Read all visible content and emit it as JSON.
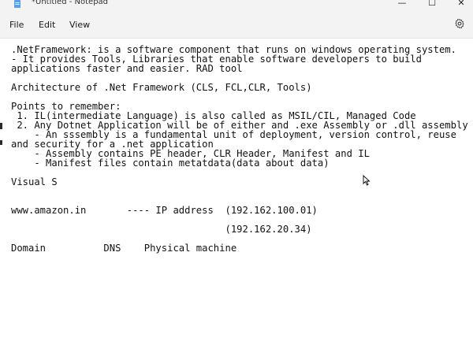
{
  "window": {
    "title": "*Untitled - Notepad",
    "minimize": "—",
    "maximize": "☐",
    "close": "✕"
  },
  "menu": {
    "items": [
      "File",
      "Edit",
      "View"
    ],
    "settings_icon": "gear-icon"
  },
  "document": {
    "lines": [
      ".NetFramework: is a software component that runs on windows operating system.",
      "- It provides Tools, Libraries that enable software developers to build",
      "applications faster and easier. RAD tool",
      "",
      "Architecture of .Net Framework (CLS, FCL,CLR, Tools)",
      "",
      "Points to remember:",
      " 1. IL(intermediate Language) is also called as MSIL/CIL, Managed Code",
      " 2. Any Dotnet Application will be of either and .exe Assembly or .dll assembly",
      "    - An sssembly is a fundamental unit of deployment, version control, reuse",
      "and security for a .net application",
      "    - Assembly contains PE header, CLR Header, Manifest and IL",
      "    - Manifest files contain metatdata(data about data)",
      "",
      "Visual S",
      "",
      "",
      "www.amazon.in       ---- IP address  (192.162.100.01)",
      "",
      "                                     (192.162.20.34)",
      "",
      "Domain          DNS    Physical machine"
    ]
  }
}
